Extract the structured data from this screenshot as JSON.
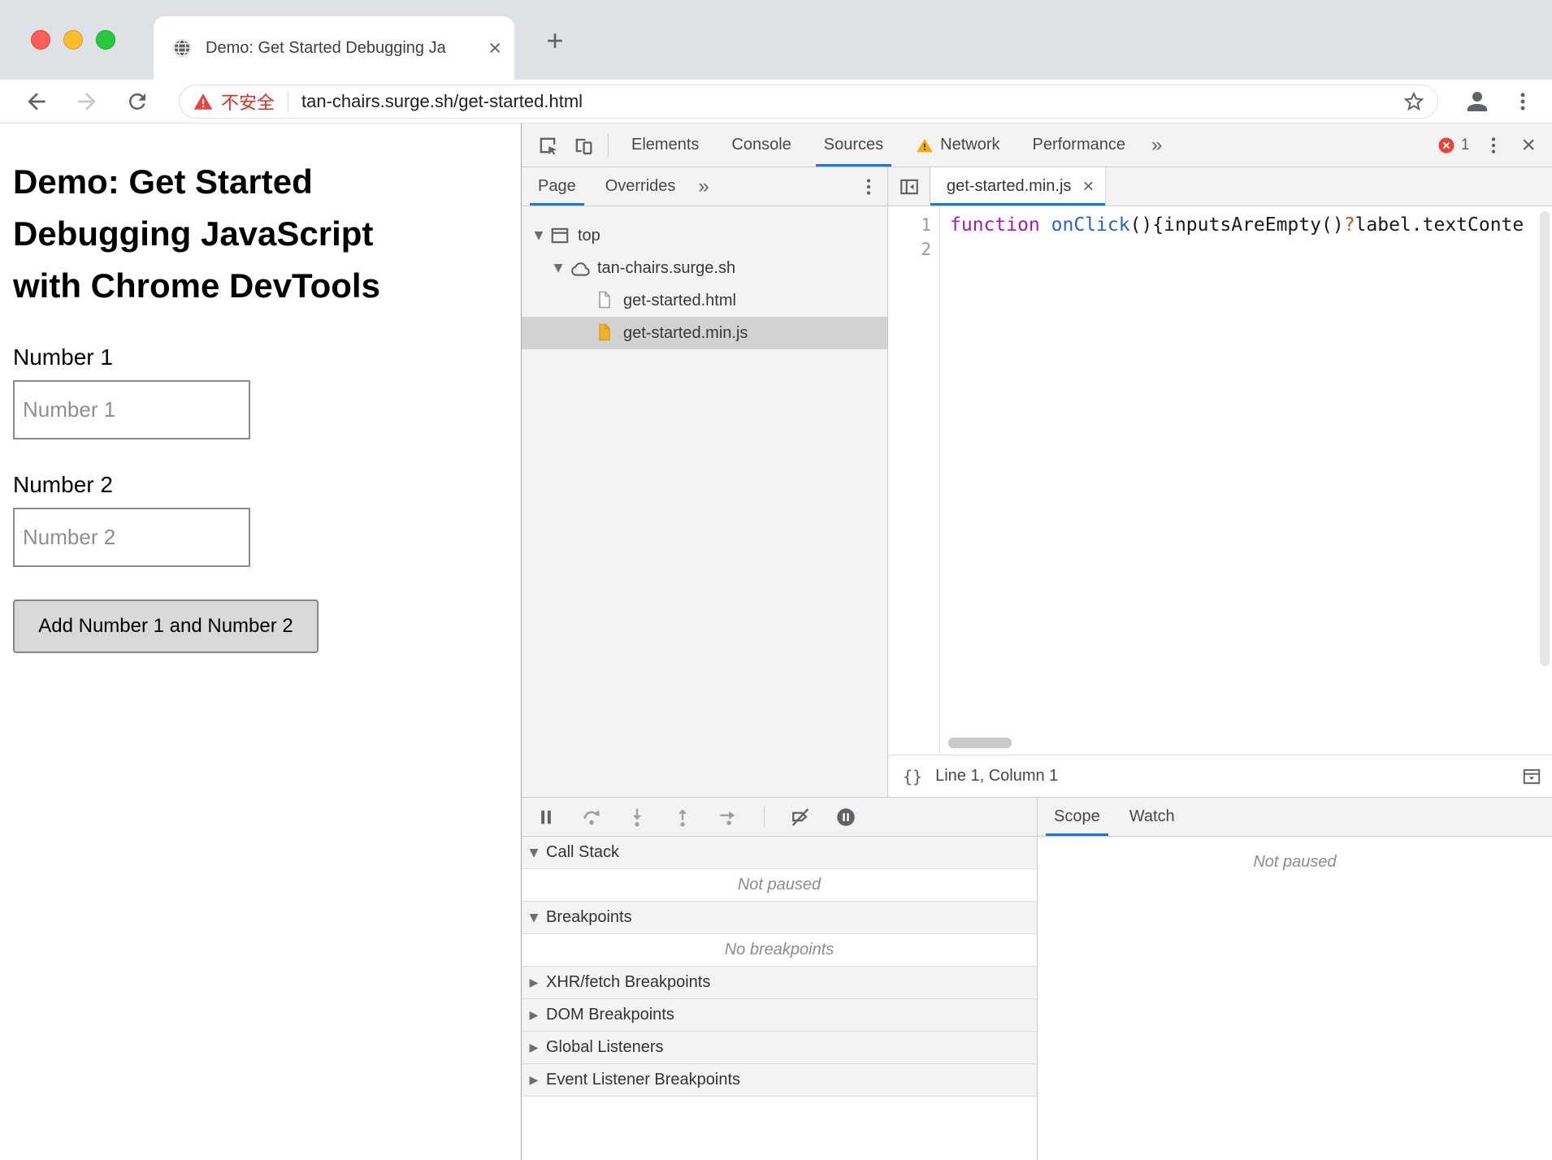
{
  "glyphs": {
    "close": "×",
    "plus": "+",
    "chevron": "»"
  },
  "browser": {
    "tab_title": "Demo: Get Started Debugging Ja",
    "not_secure": "不安全",
    "url": "tan-chairs.surge.sh/get-started.html"
  },
  "page": {
    "heading": "Demo: Get Started Debugging JavaScript with Chrome DevTools",
    "fields": [
      {
        "label": "Number 1",
        "placeholder": "Number 1"
      },
      {
        "label": "Number 2",
        "placeholder": "Number 2"
      }
    ],
    "button": "Add Number 1 and Number 2"
  },
  "devtools": {
    "toolbar": {
      "tabs": [
        {
          "label": "Elements"
        },
        {
          "label": "Console"
        },
        {
          "label": "Sources"
        },
        {
          "label": "Network"
        },
        {
          "label": "Performance"
        }
      ],
      "active_tab": "Sources",
      "error_count": "1"
    },
    "navigator": {
      "tabs": [
        {
          "label": "Page"
        },
        {
          "label": "Overrides"
        }
      ],
      "active_tab": "Page",
      "tree": [
        {
          "arrow": "▼",
          "label": "top"
        },
        {
          "arrow": "▼",
          "label": "tan-chairs.surge.sh"
        },
        {
          "label": "get-started.html"
        },
        {
          "label": "get-started.min.js",
          "selected": true
        }
      ]
    },
    "editor": {
      "file_tab": "get-started.min.js",
      "line_numbers": [
        "1",
        "2"
      ],
      "code_tokens": {
        "keyword": "function",
        "function_name": "onClick",
        "paren1": "(){",
        "identifier": "inputsAreEmpty",
        "paren2": "()",
        "operator": "?",
        "tail": "label.textConte"
      },
      "pretty_print": "{}",
      "status": "Line 1, Column 1"
    },
    "debugger": {
      "sections": [
        {
          "arrow": "▼",
          "title": "Call Stack",
          "content": "Not paused"
        },
        {
          "arrow": "▼",
          "title": "Breakpoints",
          "content": "No breakpoints"
        },
        {
          "arrow": "▶",
          "title": "XHR/fetch Breakpoints"
        },
        {
          "arrow": "▶",
          "title": "DOM Breakpoints"
        },
        {
          "arrow": "▶",
          "title": "Global Listeners"
        },
        {
          "arrow": "▶",
          "title": "Event Listener Breakpoints"
        }
      ]
    },
    "watch_pane": {
      "tabs": [
        {
          "label": "Scope"
        },
        {
          "label": "Watch"
        }
      ],
      "active_tab": "Scope",
      "content": "Not paused"
    }
  },
  "colors": {
    "accent_blue": "#1a73e8",
    "not_secure_red": "#d93025",
    "warning_yellow": "#f9ab00",
    "error_red": "#ea4335",
    "keyword_purple": "#a31db1",
    "function_blue": "#2962cc",
    "operator_orange": "#c3571c"
  }
}
